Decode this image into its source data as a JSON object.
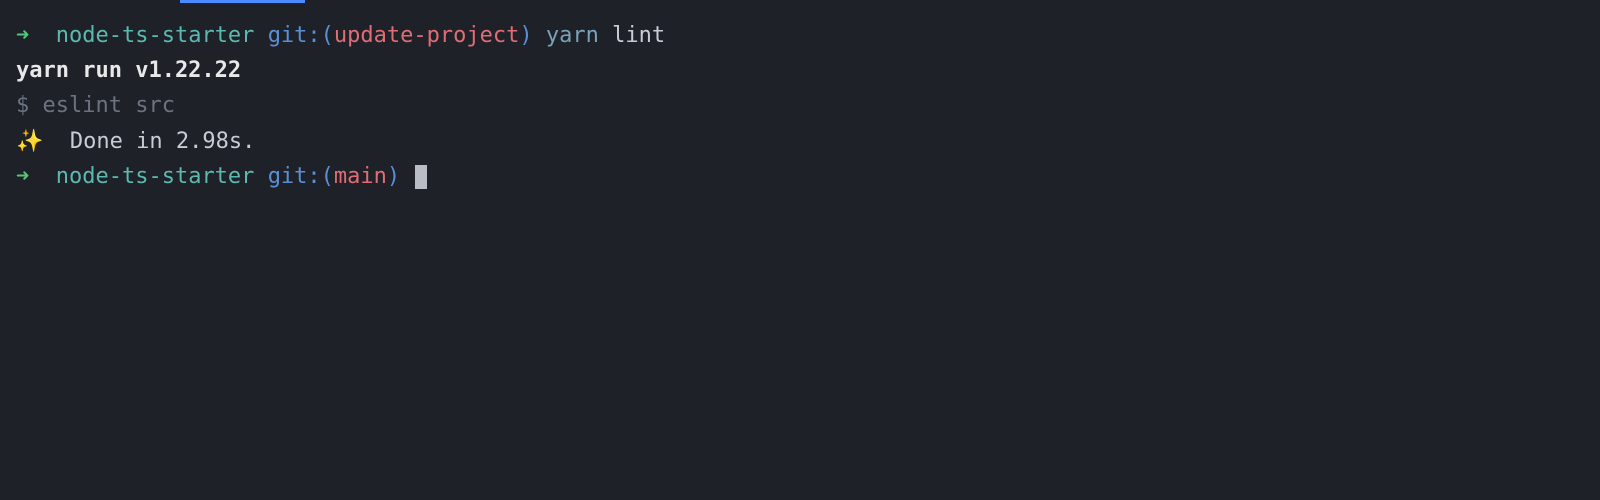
{
  "prompt1": {
    "arrow": "➜",
    "directory": "node-ts-starter",
    "git_label": "git:",
    "paren_open": "(",
    "branch": "update-project",
    "paren_close": ")",
    "command": "yarn",
    "command_arg": "lint"
  },
  "output": {
    "yarn_version": "yarn run v1.22.22",
    "exec_prefix": "$ ",
    "exec_cmd": "eslint src",
    "sparkle": "✨",
    "done_text": "  Done in 2.98s."
  },
  "prompt2": {
    "arrow": "➜",
    "directory": "node-ts-starter",
    "git_label": "git:",
    "paren_open": "(",
    "branch": "main",
    "paren_close": ")"
  }
}
